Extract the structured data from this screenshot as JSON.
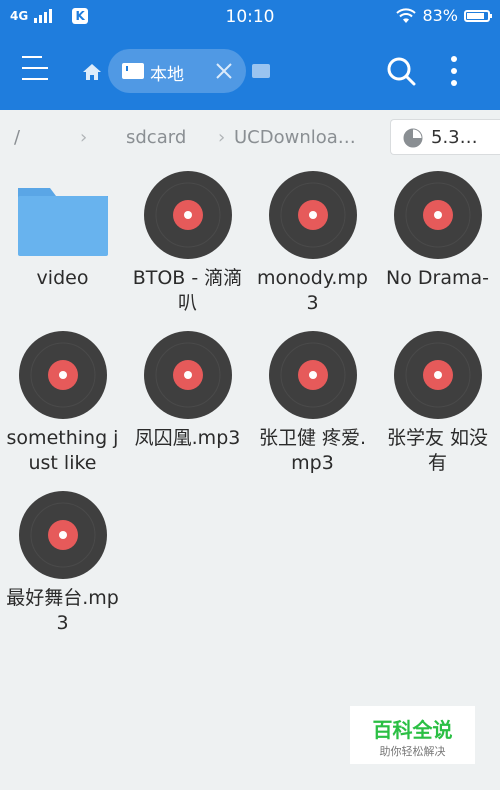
{
  "status_bar": {
    "network": "4G",
    "app_icon_letter": "K",
    "time": "10:10",
    "battery": "83%",
    "battery_level": 0.83
  },
  "app_bar": {
    "tab_label": "本地",
    "colors": {
      "primary": "#1f7ddd"
    }
  },
  "breadcrumb": {
    "items": [
      "/",
      "sdcard",
      "UCDownloa…"
    ],
    "storage": "5.3…"
  },
  "files": [
    {
      "name": "video",
      "type": "folder"
    },
    {
      "name": "BTOB - 滴滴叭",
      "type": "music"
    },
    {
      "name": "monody.mp3",
      "type": "music"
    },
    {
      "name": "No Drama-",
      "type": "music"
    },
    {
      "name": "something just like",
      "type": "music"
    },
    {
      "name": "凤囚凰.mp3",
      "type": "music"
    },
    {
      "name": "张卫健 疼爱.mp3",
      "type": "music"
    },
    {
      "name": "张学友 如没有",
      "type": "music"
    },
    {
      "name": "最好舞台.mp3",
      "type": "music"
    }
  ],
  "watermark": {
    "title": "百科全说",
    "subtitle": "助你轻松解决"
  }
}
